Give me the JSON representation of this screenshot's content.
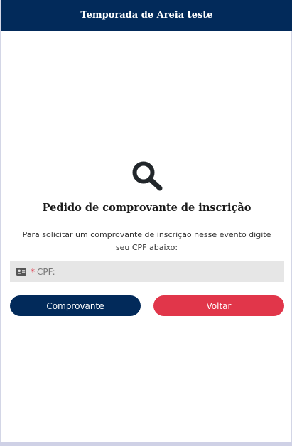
{
  "header": {
    "title": "Temporada de Areia teste"
  },
  "main": {
    "icon": "search-icon",
    "title": "Pedido de comprovante de inscrição",
    "instructions": "Para solicitar um comprovante de inscrição nesse evento digite seu CPF abaixo:",
    "cpf_field": {
      "icon": "id-card-icon",
      "required_mark": "*",
      "placeholder": "CPF:",
      "value": ""
    },
    "buttons": {
      "comprovante_label": "Comprovante",
      "voltar_label": "Voltar"
    }
  },
  "colors": {
    "header_bg": "#022a5a",
    "primary_button": "#022a5a",
    "secondary_button": "#e1364a",
    "required": "#e03a4b",
    "field_bg": "#e6e6e6"
  }
}
